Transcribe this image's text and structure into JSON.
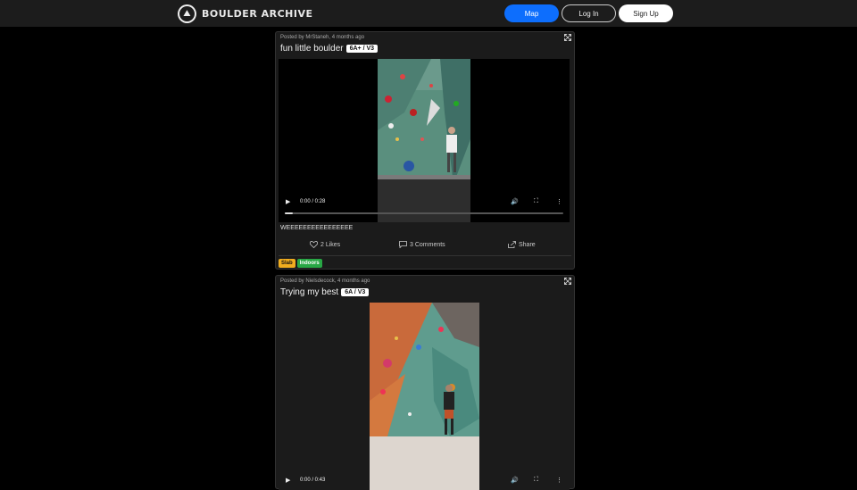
{
  "navbar": {
    "brand": "BOULDER ARCHIVE",
    "map_label": "Map",
    "login_label": "Log In",
    "signup_label": "Sign Up",
    "accent_color": "#0d6efd"
  },
  "posts": [
    {
      "meta": "Posted by MrStaneh, 4 months ago",
      "title": "fun little boulder",
      "grade": "6A+ / V3",
      "video_time": "0:00 / 0:28",
      "progress": 0.03,
      "description": "WEEEEEEEEEEEEEEEE",
      "likes": "2 Likes",
      "comments": "3 Comments",
      "share": "Share",
      "tags": [
        {
          "label": "Slab",
          "color": "#f0ad1f"
        },
        {
          "label": "Indoors",
          "color": "#28a745"
        }
      ]
    },
    {
      "meta": "Posted by Nielsdecock, 4 months ago",
      "title": "Trying my best",
      "grade": "6A / V3",
      "video_time": "0:00 / 0:43"
    }
  ]
}
